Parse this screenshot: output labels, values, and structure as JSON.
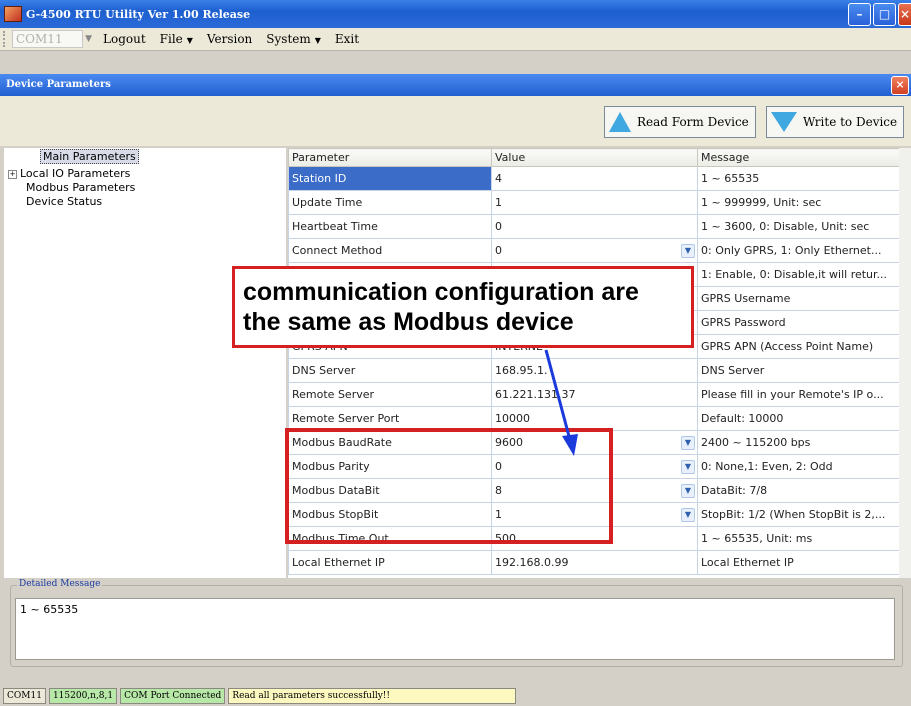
{
  "window": {
    "title": "G-4500 RTU Utility Ver 1.00 Release"
  },
  "menubar": {
    "port": "COM11",
    "items": [
      "Logout",
      "File",
      "Version",
      "System",
      "Exit"
    ]
  },
  "dialog": {
    "title": "Device Parameters"
  },
  "toolbar": {
    "read_label": "Read Form Device",
    "write_label": "Write to Device"
  },
  "tree": {
    "items": [
      "Main Parameters",
      "Local IO Parameters",
      "Modbus Parameters",
      "Device Status"
    ]
  },
  "grid": {
    "headers": [
      "Parameter",
      "Value",
      "Message"
    ],
    "rows": [
      {
        "p": "Station ID",
        "v": "4",
        "m": "1 ~ 65535"
      },
      {
        "p": "Update Time",
        "v": "1",
        "m": "1 ~ 999999, Unit: sec"
      },
      {
        "p": "Heartbeat Time",
        "v": "0",
        "m": "1 ~ 3600, 0: Disable, Unit: sec"
      },
      {
        "p": "Connect Method",
        "v": "0",
        "m": "0: Only GPRS, 1: Only Ethernet..."
      },
      {
        "p": "",
        "v": "",
        "m": "1: Enable, 0: Disable,it will retur..."
      },
      {
        "p": "",
        "v": "",
        "m": "GPRS Username"
      },
      {
        "p": "",
        "v": "",
        "m": "GPRS Password"
      },
      {
        "p": "GPRS APN",
        "v": "INTERNE",
        "m": "GPRS APN (Access Point Name)"
      },
      {
        "p": "DNS Server",
        "v": "168.95.1.",
        "m": "DNS Server"
      },
      {
        "p": "Remote Server",
        "v": "61.221.131.37",
        "m": "Please fill in your Remote's IP o..."
      },
      {
        "p": "Remote Server Port",
        "v": "10000",
        "m": "Default: 10000"
      },
      {
        "p": "Modbus BaudRate",
        "v": "9600",
        "m": "2400 ~ 115200 bps"
      },
      {
        "p": "Modbus Parity",
        "v": "0",
        "m": "0: None,1: Even, 2: Odd"
      },
      {
        "p": "Modbus DataBit",
        "v": "8",
        "m": "DataBit: 7/8"
      },
      {
        "p": "Modbus StopBit",
        "v": "1",
        "m": "StopBit: 1/2 (When StopBit is 2,..."
      },
      {
        "p": "Modbus Time Out",
        "v": "500",
        "m": "1 ~ 65535, Unit: ms"
      },
      {
        "p": "Local Ethernet IP",
        "v": "192.168.0.99",
        "m": "Local Ethernet IP"
      }
    ]
  },
  "detail": {
    "label": "Detailed Message",
    "text": "1 ~ 65535"
  },
  "status": {
    "port": "COM11",
    "setting": "115200,n,8,1",
    "connection": "COM Port Connected",
    "message": "Read all parameters successfully!!"
  },
  "annotation": {
    "line1": "communication configuration are",
    "line2": "the same as Modbus device"
  }
}
